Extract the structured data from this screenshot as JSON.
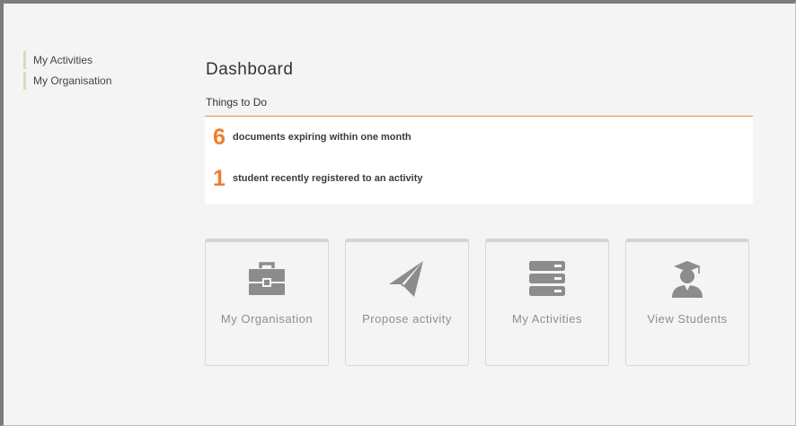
{
  "sidebar": {
    "items": [
      {
        "label": "My Activities"
      },
      {
        "label": "My Organisation"
      }
    ]
  },
  "main": {
    "title": "Dashboard",
    "section_title": "Things to Do",
    "todos": [
      {
        "count": "6",
        "text": "documents expiring within one month"
      },
      {
        "count": "1",
        "text": "student recently registered to an activity"
      }
    ],
    "tiles": [
      {
        "label": "My Organisation",
        "icon": "briefcase-icon"
      },
      {
        "label": "Propose activity",
        "icon": "paper-plane-icon"
      },
      {
        "label": "My Activities",
        "icon": "server-list-icon"
      },
      {
        "label": "View Students",
        "icon": "graduate-student-icon"
      }
    ]
  },
  "colors": {
    "accent": "#f07d2a",
    "tile_icon": "#8c8c8c",
    "sidebar_marker": "#e0d7bd"
  }
}
